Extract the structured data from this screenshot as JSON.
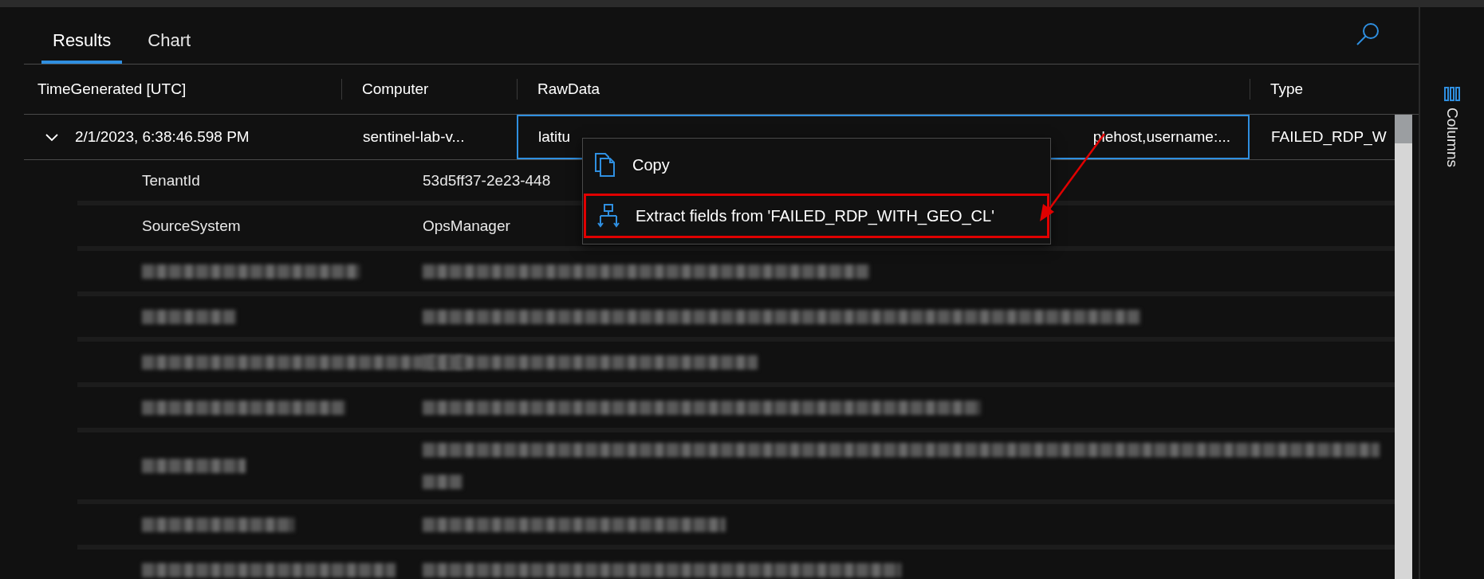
{
  "tabs": [
    {
      "label": "Results",
      "selected": true
    },
    {
      "label": "Chart",
      "selected": false
    }
  ],
  "table": {
    "columns": [
      "TimeGenerated [UTC]",
      "Computer",
      "RawData",
      "Type"
    ],
    "row": {
      "expanded": true,
      "cells": [
        {
          "text": "2/1/2023, 6:38:46.598 PM",
          "selected": false
        },
        {
          "text": "sentinel-lab-v...",
          "selected": false
        },
        {
          "text_start": "latitu",
          "text_end": "plehost,username:...",
          "selected": true
        },
        {
          "text": "FAILED_RDP_W",
          "selected": false
        }
      ]
    },
    "details": [
      {
        "kind": "field",
        "name": "TenantId",
        "value": "53d5ff37-2e23-448"
      },
      {
        "kind": "field",
        "name": "SourceSystem",
        "value": "OpsManager"
      },
      {
        "kind": "redacted"
      },
      {
        "kind": "redacted"
      },
      {
        "kind": "redacted"
      },
      {
        "kind": "redacted"
      },
      {
        "kind": "redacted_multiline"
      },
      {
        "kind": "redacted"
      },
      {
        "kind": "redacted"
      }
    ]
  },
  "context_menu": {
    "items": [
      {
        "kind": "copy",
        "label": "Copy",
        "highlighted": false
      },
      {
        "kind": "extract",
        "label": "Extract fields from 'FAILED_RDP_WITH_GEO_CL'",
        "highlighted": true
      }
    ]
  },
  "side_panel": {
    "label": "Columns"
  }
}
